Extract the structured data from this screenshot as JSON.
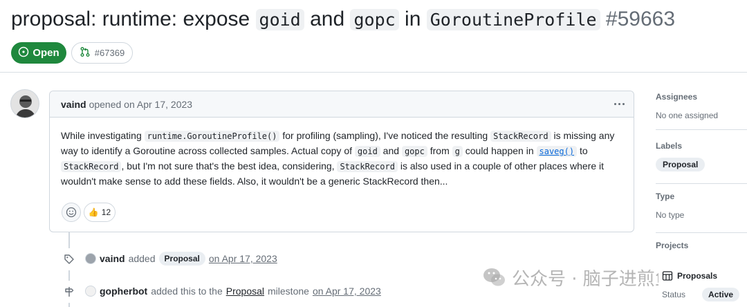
{
  "issue": {
    "title_prefix": "proposal: runtime: expose ",
    "title_code1": "goid",
    "title_mid1": " and ",
    "title_code2": "gopc",
    "title_mid2": " in ",
    "title_code3": "GoroutineProfile",
    "number": "#59663",
    "state": "Open",
    "linked_pr": "#67369",
    "state_color": "#1f883d"
  },
  "comment": {
    "author": "vaind",
    "action": "opened on Apr 17, 2023",
    "body": {
      "p1": "While investigating ",
      "c1": "runtime.GoroutineProfile()",
      "p2": " for profiling (sampling), I've noticed the resulting ",
      "c2": "StackRecord",
      "p3": " is missing any way to identify a Goroutine across collected samples. Actual copy of ",
      "c3": "goid",
      "p4": " and ",
      "c4": "gopc",
      "p5": " from ",
      "c5": "g",
      "p6": " could happen in ",
      "link": "saveg()",
      "p7": " to ",
      "c6": "StackRecord",
      "p8": ", but I'm not sure that's the best idea, considering, ",
      "c7": "StackRecord",
      "p9": " is also used in a couple of other places where it wouldn't make sense to add these fields. Also, it wouldn't be a generic StackRecord then..."
    },
    "reaction_emoji": "👍",
    "reaction_count": "12"
  },
  "timeline": [
    {
      "actor": "vaind",
      "verb": "added",
      "label": "Proposal",
      "when": "on Apr 17, 2023"
    },
    {
      "actor": "gopherbot",
      "verb": "added this to the",
      "milestone": "Proposal",
      "suffix": "milestone",
      "when": "on Apr 17, 2023"
    }
  ],
  "sidebar": {
    "assignees_heading": "Assignees",
    "assignees_value": "No one assigned",
    "labels_heading": "Labels",
    "labels_value": "Proposal",
    "type_heading": "Type",
    "type_value": "No type",
    "projects_heading": "Projects",
    "project_name": "Proposals",
    "status_label": "Status",
    "status_value": "Active"
  },
  "watermark": {
    "text": "公众号 · 脑子进煎鱼了"
  }
}
